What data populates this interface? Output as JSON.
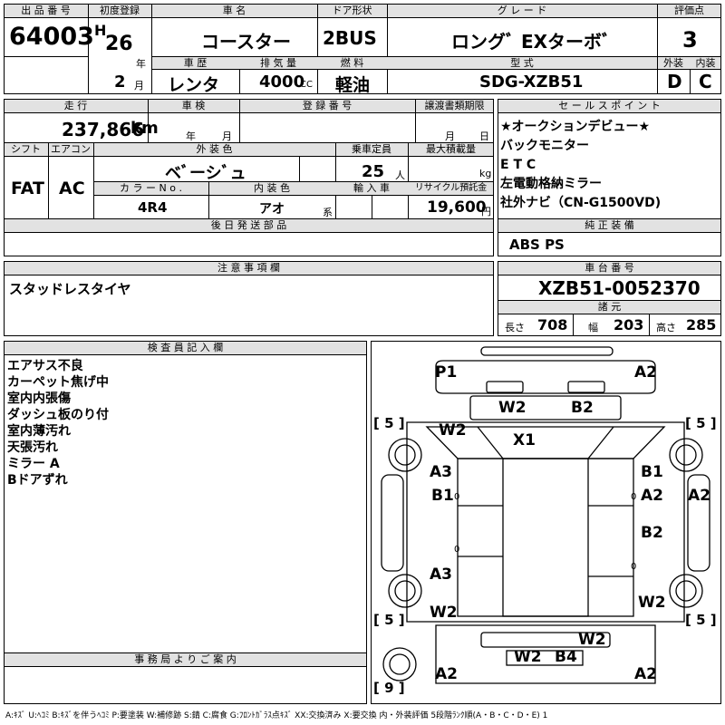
{
  "header": {
    "lot_label": "出 品 番 号",
    "lot_number": "64003",
    "first_reg_label": "初度登録",
    "era": "H",
    "year_val": "26",
    "year_unit": "年",
    "month_val": "2",
    "month_unit": "月",
    "car_name_label": "車 名",
    "car_name": "コースター",
    "history_label": "車 歴",
    "history": "レンタ",
    "displacement_label": "排 気 量",
    "displacement": "4000",
    "displacement_unit": "CC",
    "door_label": "ドア形状",
    "door": "2BUS",
    "fuel_label": "燃 料",
    "fuel": "軽油",
    "grade_label": "グ レ ー ド",
    "grade": "ロングﾞ EXターボﾞ",
    "model_label": "型 式",
    "model": "SDG-XZB51",
    "score_label": "評価点",
    "score": "3",
    "ext_label": "外装",
    "ext": "D",
    "int_label": "内装",
    "int": "C"
  },
  "mid": {
    "mileage_label": "走 行",
    "mileage": "237,866",
    "mileage_unit": "km",
    "inspection_label": "車 検",
    "insp_year_unit": "年",
    "insp_month_unit": "月",
    "reg_label": "登 録 番 号",
    "transfer_label": "譲渡書類期限",
    "tr_month_unit": "月",
    "tr_day_unit": "日",
    "shift_label": "シフト",
    "shift": "FAT",
    "ac_label": "エアコン",
    "ac": "AC",
    "color_label": "外 装 色",
    "color": "ベﾞーシﾞュ",
    "color_no_label": "カ ラ ー N o .",
    "color_no": "4R4",
    "int_color_label": "内 装 色",
    "int_color": "アオ",
    "int_color_unit": "系",
    "seats_label": "乗車定員",
    "seats": "25",
    "seats_unit": "人",
    "load_label": "最大積載量",
    "load_unit": "kg",
    "import_label": "輸 入 車",
    "recycle_label": "リサイクル預託金",
    "recycle": "19,600",
    "recycle_unit": "円",
    "delivery_label": "後 日 発 送 部 品"
  },
  "sales": {
    "label": "セ ー ル ス ポ イ ン ト",
    "lines": [
      "★オークションデビュー★",
      "バックモニター",
      "E T C",
      "左電動格納ミラー",
      "社外ナビ（CN-G1500VD)"
    ],
    "equip_label": "純 正 装 備",
    "equip": "ABS PS"
  },
  "notes": {
    "label": "注 意 事 項 欄",
    "text": "スタッドレスタイヤ"
  },
  "chassis": {
    "label": "車 台 番 号",
    "number": "XZB51-0052370",
    "spec_label": "諸 元",
    "len_label": "長さ",
    "len": "708",
    "wid_label": "幅",
    "wid": "203",
    "hei_label": "高さ",
    "hei": "285"
  },
  "inspector": {
    "label": "検 査 員 記 入 欄",
    "lines": [
      "エアサス不良",
      "カーペット焦げ中",
      "室内内張傷",
      "ダッシュ板のり付",
      "室内薄汚れ",
      "天張汚れ",
      "ミラー A",
      "Bドアずれ"
    ]
  },
  "office": {
    "label": "事 務 局 よ り ご 案 内"
  },
  "diagram": {
    "marks": [
      "P1",
      "A2",
      "W2",
      "B2",
      "W2",
      "X1",
      "A3",
      "B1",
      "B1",
      "A2",
      "A2",
      "B2",
      "A3",
      "W2",
      "W2",
      "W2",
      "W2",
      "B4",
      "A2",
      "A2"
    ],
    "tires": [
      "[ 5 ]",
      "[ 5 ]",
      "[ 5 ]",
      "[ 5 ]",
      "[ 9 ]"
    ],
    "small": [
      "0",
      "0",
      "0",
      "0"
    ]
  },
  "legend": "A:ｷｽﾞ U:ﾍｺﾐ B:ｷｽﾞを伴うﾍｺﾐ P:要塗装 W:補修跡 S:錆 C:腐食 G:ﾌﾛﾝﾄｶﾞﾗｽ点ｷｽﾞ XX:交換済み X:要交換 内・外装評価 5段階ﾗﾝｸ順(A・B・C・D・E) 1"
}
